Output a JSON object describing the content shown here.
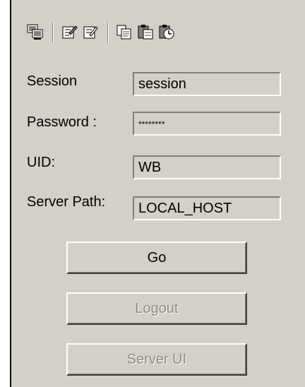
{
  "toolbar": {
    "icons": [
      "console-icon",
      "edit-properties-icon",
      "edit-properties-alt-icon",
      "copy-icon",
      "paste-icon",
      "schedule-icon"
    ]
  },
  "form": {
    "session_label": "Session",
    "session_value": "session",
    "password_label": "Password :",
    "password_value": "********",
    "uid_label": "UID:",
    "uid_value": "WB",
    "server_path_label": "Server Path:",
    "server_path_value": "LOCAL_HOST"
  },
  "buttons": {
    "go": "Go",
    "logout": "Logout",
    "server_ui": "Server UI"
  },
  "colors": {
    "panel_bg": "#d4d0c8",
    "disabled_text": "#8e8b84"
  }
}
